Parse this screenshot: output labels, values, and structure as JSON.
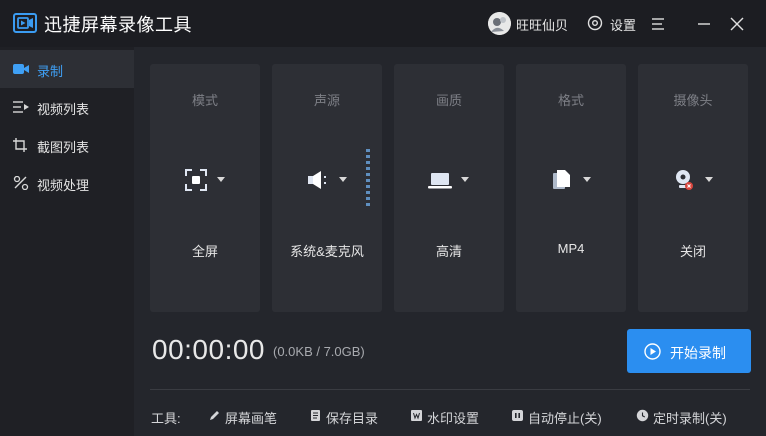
{
  "app": {
    "title": "迅捷屏幕录像工具"
  },
  "header": {
    "username": "旺旺仙贝",
    "settings_label": "设置"
  },
  "sidebar": {
    "items": [
      {
        "label": "录制",
        "active": true
      },
      {
        "label": "视频列表"
      },
      {
        "label": "截图列表"
      },
      {
        "label": "视频处理"
      }
    ]
  },
  "cards": [
    {
      "title": "模式",
      "value": "全屏",
      "icon": "fullscreen-icon"
    },
    {
      "title": "声源",
      "value": "系统&麦克风",
      "icon": "speaker-icon"
    },
    {
      "title": "画质",
      "value": "高清",
      "icon": "laptop-icon"
    },
    {
      "title": "格式",
      "value": "MP4",
      "icon": "file-icon"
    },
    {
      "title": "摄像头",
      "value": "关闭",
      "icon": "webcam-icon"
    }
  ],
  "recording": {
    "timer": "00:00:00",
    "size_info": "(0.0KB / 7.0GB)",
    "start_label": "开始录制"
  },
  "tools": {
    "label": "工具:",
    "items": [
      {
        "label": "屏幕画笔",
        "icon": "pen-icon"
      },
      {
        "label": "保存目录",
        "icon": "document-icon"
      },
      {
        "label": "水印设置",
        "icon": "watermark-icon"
      },
      {
        "label": "自动停止(关)",
        "icon": "pause-icon"
      },
      {
        "label": "定时录制(关)",
        "icon": "clock-icon"
      }
    ]
  },
  "colors": {
    "accent": "#2b8ef0",
    "active_nav": "#3fa0f5",
    "card_bg": "#2d2f35",
    "background": "#24262c"
  }
}
